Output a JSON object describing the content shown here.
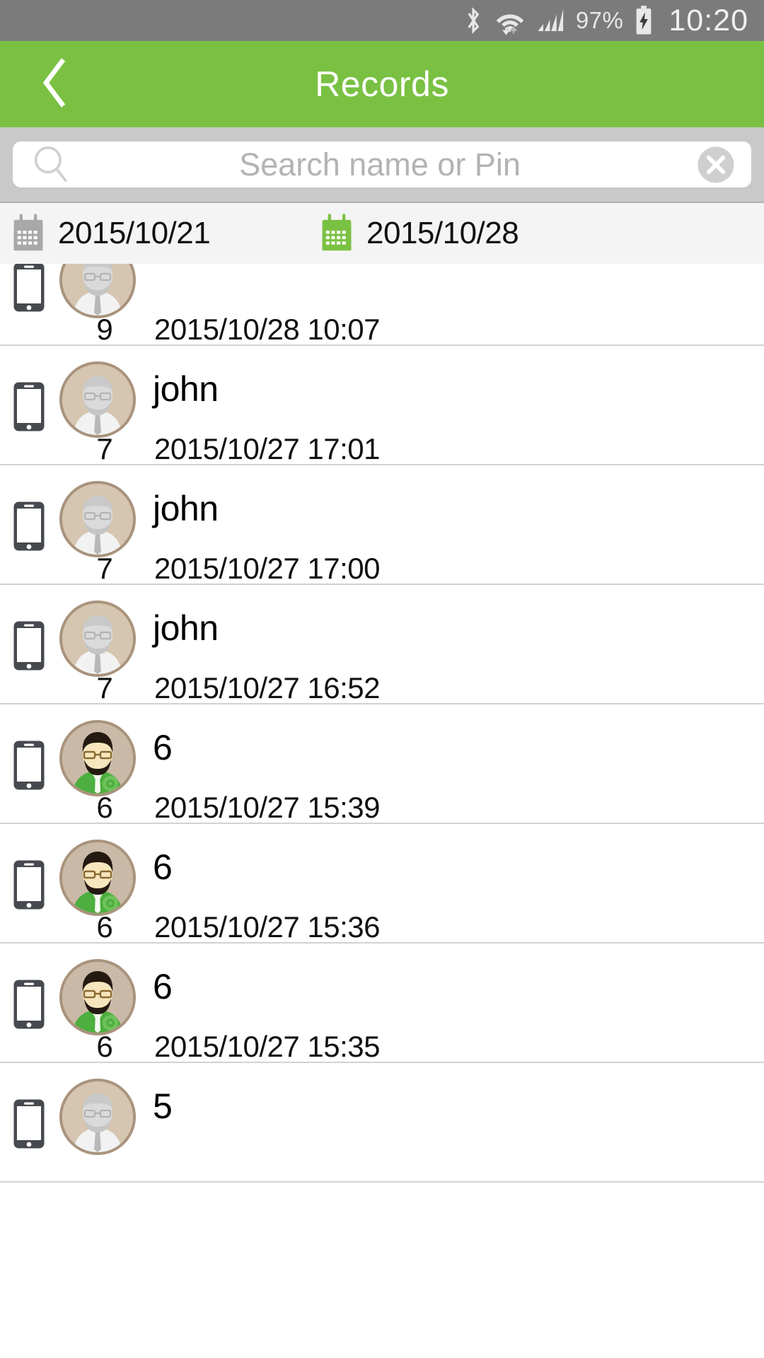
{
  "status_bar": {
    "bluetooth_icon": "bluetooth-icon",
    "wifi_icon": "wifi-icon",
    "signal_icon": "cellular-signal-icon",
    "battery_percent": "97%",
    "battery_icon": "battery-charging-icon",
    "clock": "10:20",
    "background_color": "#7b7b7b"
  },
  "app_bar": {
    "back_icon": "back-chevron-icon",
    "title": "Records",
    "background_color": "#7ac143"
  },
  "search": {
    "placeholder": "Search name or Pin",
    "value": "",
    "search_icon": "search-icon",
    "clear_icon": "clear-circle-icon"
  },
  "date_filter": {
    "start": {
      "icon": "calendar-icon-gray",
      "label": "2015/10/21",
      "color": "#a8a8a8"
    },
    "end": {
      "icon": "calendar-icon-green",
      "label": "2015/10/28",
      "color": "#7ac143"
    }
  },
  "records": [
    {
      "device_icon": "smartphone-icon",
      "avatar": "gray-haired-man-avatar",
      "name": "",
      "pin": "9",
      "timestamp": "2015/10/28 10:07"
    },
    {
      "device_icon": "smartphone-icon",
      "avatar": "gray-haired-man-avatar",
      "name": "john",
      "pin": "7",
      "timestamp": "2015/10/27 17:01"
    },
    {
      "device_icon": "smartphone-icon",
      "avatar": "gray-haired-man-avatar",
      "name": "john",
      "pin": "7",
      "timestamp": "2015/10/27 17:00"
    },
    {
      "device_icon": "smartphone-icon",
      "avatar": "gray-haired-man-avatar",
      "name": "john",
      "pin": "7",
      "timestamp": "2015/10/27 16:52"
    },
    {
      "device_icon": "smartphone-icon",
      "avatar": "dark-haired-man-green-shirt-avatar",
      "name": "6",
      "pin": "6",
      "timestamp": "2015/10/27 15:39"
    },
    {
      "device_icon": "smartphone-icon",
      "avatar": "dark-haired-man-green-shirt-avatar",
      "name": "6",
      "pin": "6",
      "timestamp": "2015/10/27 15:36"
    },
    {
      "device_icon": "smartphone-icon",
      "avatar": "dark-haired-man-green-shirt-avatar",
      "name": "6",
      "pin": "6",
      "timestamp": "2015/10/27 15:35"
    },
    {
      "device_icon": "smartphone-icon",
      "avatar": "gray-haired-man-avatar",
      "name": "5",
      "pin": "",
      "timestamp": ""
    }
  ]
}
